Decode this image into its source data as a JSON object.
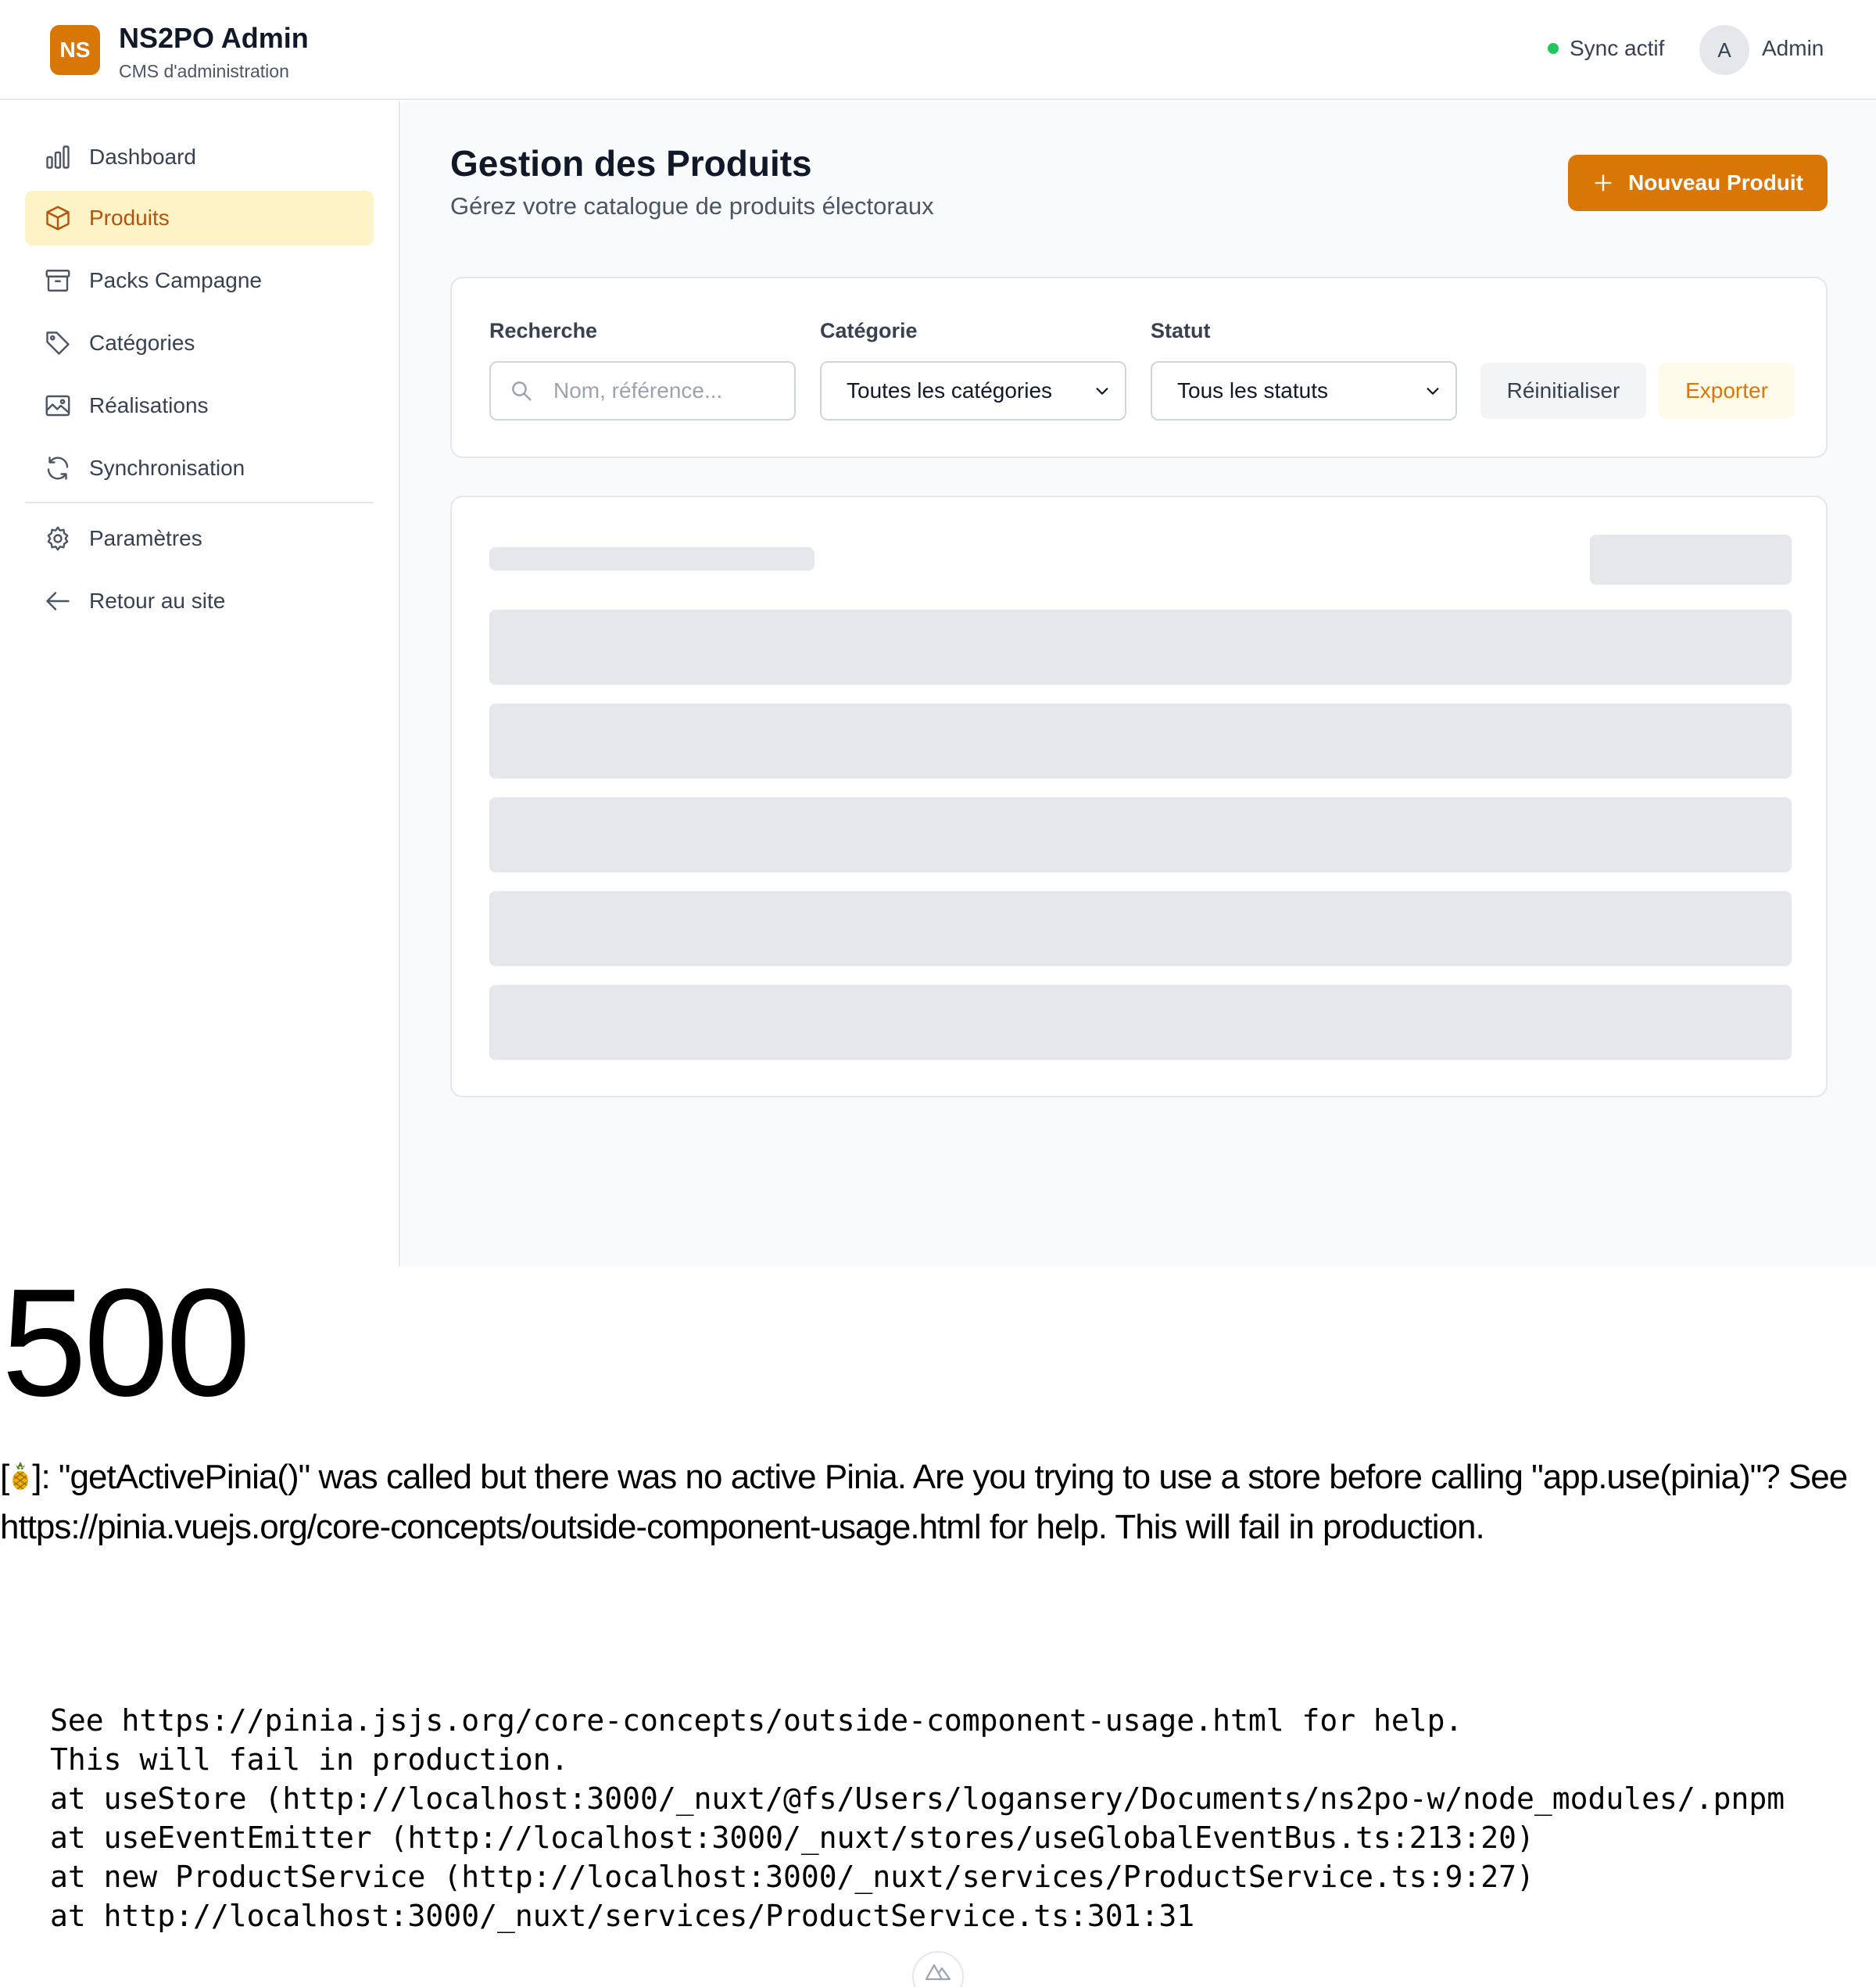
{
  "header": {
    "logo_text": "NS",
    "app_title": "NS2PO Admin",
    "app_subtitle": "CMS d'administration",
    "sync_status": "Sync actif",
    "avatar_initial": "A",
    "user_name": "Admin"
  },
  "sidebar": {
    "items": [
      {
        "label": "Dashboard",
        "icon": "bar-chart-icon"
      },
      {
        "label": "Produits",
        "icon": "box-icon",
        "active": true
      },
      {
        "label": "Packs Campagne",
        "icon": "archive-icon"
      },
      {
        "label": "Catégories",
        "icon": "tag-icon"
      },
      {
        "label": "Réalisations",
        "icon": "image-icon"
      },
      {
        "label": "Synchronisation",
        "icon": "refresh-icon"
      }
    ],
    "secondary_items": [
      {
        "label": "Paramètres",
        "icon": "gear-icon"
      },
      {
        "label": "Retour au site",
        "icon": "arrow-left-icon"
      }
    ]
  },
  "main": {
    "title": "Gestion des Produits",
    "subtitle": "Gérez votre catalogue de produits électoraux",
    "new_button": "Nouveau Produit",
    "filters": {
      "search_label": "Recherche",
      "search_placeholder": "Nom, référence...",
      "category_label": "Catégorie",
      "category_value": "Toutes les catégories",
      "status_label": "Statut",
      "status_value": "Tous les statuts",
      "reset_button": "Réinitialiser",
      "export_button": "Exporter"
    }
  },
  "error": {
    "code": "500",
    "message_prefix": "[",
    "message": "]: \"getActivePinia()\" was called but there was no active Pinia. Are you trying to use a store before calling \"app.use(pinia)\"? See https://pinia.vuejs.org/core-concepts/outside-component-usage.html for help. This will fail in production.",
    "stack": [
      "See https://pinia.jsjs.org/core-concepts/outside-component-usage.html for help.",
      "This will fail in production.",
      "at useStore (http://localhost:3000/_nuxt/@fs/Users/logansery/Documents/ns2po-w/node_modules/.pnpm",
      "at useEventEmitter (http://localhost:3000/_nuxt/stores/useGlobalEventBus.ts:213:20)",
      "at new ProductService (http://localhost:3000/_nuxt/services/ProductService.ts:9:27)",
      "at http://localhost:3000/_nuxt/services/ProductService.ts:301:31"
    ]
  },
  "colors": {
    "brand": "#d97706",
    "active_bg": "#fef3c7",
    "active_text": "#b45309",
    "sync_dot": "#22c55e",
    "skeleton": "#e5e7eb"
  }
}
